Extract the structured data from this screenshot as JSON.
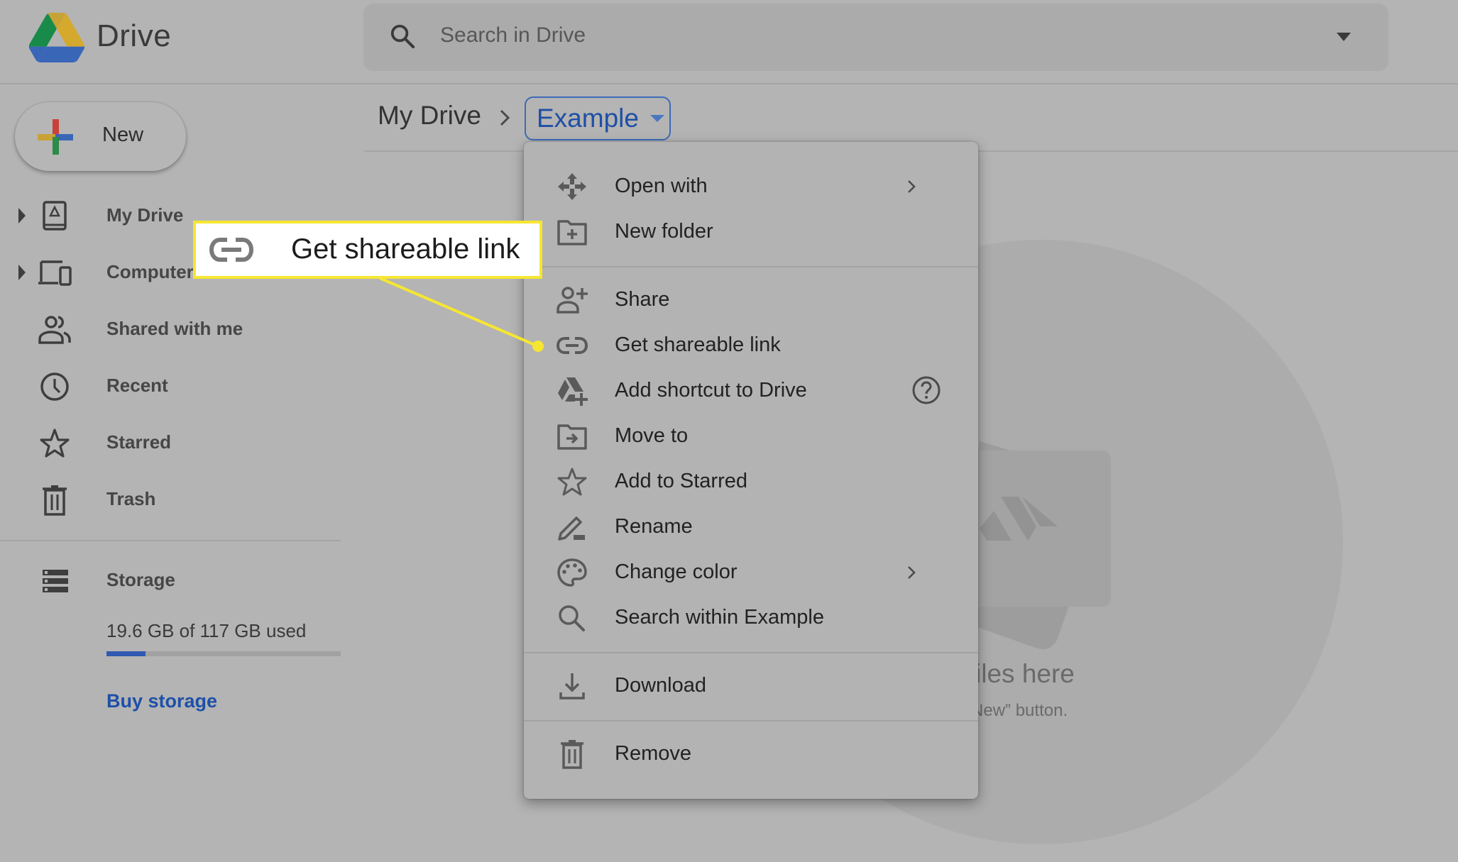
{
  "app": {
    "name": "Drive"
  },
  "search": {
    "placeholder": "Search in Drive",
    "value": ""
  },
  "breadcrumb": {
    "root": "My Drive",
    "current": "Example"
  },
  "sidebar": {
    "new_label": "New",
    "items": [
      {
        "label": "My Drive",
        "icon": "my-drive-icon",
        "expandable": true
      },
      {
        "label": "Computers",
        "icon": "computers-icon",
        "expandable": true
      },
      {
        "label": "Shared with me",
        "icon": "shared-with-me-icon",
        "expandable": false
      },
      {
        "label": "Recent",
        "icon": "clock-icon",
        "expandable": false
      },
      {
        "label": "Starred",
        "icon": "star-icon",
        "expandable": false
      },
      {
        "label": "Trash",
        "icon": "trash-icon",
        "expandable": false
      }
    ],
    "storage": {
      "label": "Storage",
      "usage_text": "19.6 GB of 117 GB used",
      "used_gb": 19.6,
      "total_gb": 117,
      "buy_label": "Buy storage"
    }
  },
  "context_menu": {
    "items": [
      {
        "label": "Open with",
        "icon": "open-with-icon",
        "submenu": true
      },
      {
        "label": "New folder",
        "icon": "new-folder-icon"
      },
      {
        "label": "Share",
        "icon": "share-person-add-icon"
      },
      {
        "label": "Get shareable link",
        "icon": "link-icon"
      },
      {
        "label": "Add shortcut to Drive",
        "icon": "add-shortcut-icon",
        "help": true
      },
      {
        "label": "Move to",
        "icon": "move-to-folder-icon"
      },
      {
        "label": "Add to Starred",
        "icon": "star-icon"
      },
      {
        "label": "Rename",
        "icon": "pencil-icon"
      },
      {
        "label": "Change color",
        "icon": "palette-icon",
        "submenu": true
      },
      {
        "label": "Search within Example",
        "icon": "search-icon"
      },
      {
        "label": "Download",
        "icon": "download-icon"
      },
      {
        "label": "Remove",
        "icon": "trash-icon"
      }
    ]
  },
  "empty_state": {
    "title": "rop files here",
    "subtitle": "e the “New” button."
  },
  "callout": {
    "label": "Get shareable link",
    "icon": "link-icon",
    "color": "#f6e632"
  },
  "colors": {
    "accent_blue": "#1e50a8",
    "storage_fill": "#2f5ab2",
    "overlay_gray": "#b4b4b4",
    "highlight_yellow": "#f6e632"
  }
}
